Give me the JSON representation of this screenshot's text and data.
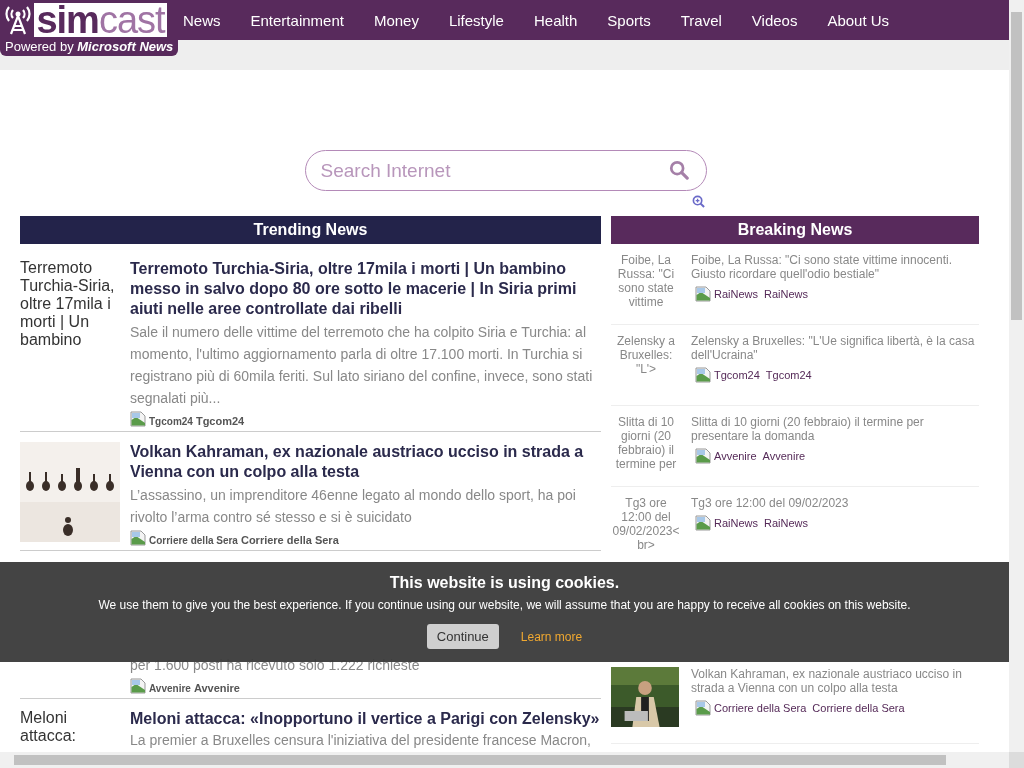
{
  "brand": {
    "logo": "**sim**cast",
    "powered_prefix": "Powered by",
    "powered_name": "Microsoft News"
  },
  "nav": [
    "News",
    "Entertainment",
    "Money",
    "Lifestyle",
    "Health",
    "Sports",
    "Travel",
    "Videos",
    "About Us"
  ],
  "search": {
    "placeholder": "Search Internet"
  },
  "trending": {
    "title": "Trending News",
    "items": [
      {
        "kind": "alt",
        "image_alt": "Terremoto Turchia-Siria, oltre 17mila i morti | Un bambino",
        "title": "Terremoto Turchia-Siria, oltre 17mila i morti | Un bambino messo in salvo dopo 80 ore sotto le macerie | In Siria primi aiuti nelle aree controllate dai ribelli",
        "summary": "Sale il numero delle vittime del terremoto che ha colpito Siria e Turchia: al momento, l'ultimo aggiornamento parla di oltre 17.100 morti. In Turchia si registrano più di 60mila feriti. Sul lato siriano del confine, invece, sono stati segnalati più...",
        "source_alt": "Tgcom24",
        "source": "Tgcom24"
      },
      {
        "kind": "picture",
        "title": "Volkan Kahraman, ex nazionale austriaco ucciso in strada a Vienna con un colpo alla testa",
        "summary": "L’assassino, un imprenditore 46enne legato al mondo dello sport, ha poi rivolto l’arma contro sé stesso e si è suicidato",
        "source_alt": "Corriere della Sera",
        "source": "Corriere della Sera"
      },
      {
        "kind": "covered",
        "summary": "per 1.600 posti ha ricevuto solo 1.222 richieste",
        "source_alt": "Avvenire",
        "source": "Avvenire"
      },
      {
        "kind": "alt",
        "image_alt": "Meloni attacca:",
        "title": "Meloni attacca: «Inopportuno il vertice a Parigi con Zelensky»",
        "summary": "La premier a Bruxelles censura l'iniziativa del presidente francese Macron,"
      }
    ]
  },
  "breaking": {
    "title": "Breaking News",
    "items": [
      {
        "kind": "alt",
        "image_alt": "Foibe, La Russa: \"Ci sono state vittime",
        "title": "Foibe, La Russa: \"Ci sono state vittime innocenti. Giusto ricordare quell'odio bestiale\"",
        "source_alt": "RaiNews",
        "source": "RaiNews"
      },
      {
        "kind": "alt",
        "image_alt": "Zelensky a Bruxelles: \"L'>",
        "title": "Zelensky a Bruxelles: \"L'Ue significa libertà, è la casa dell'Ucraina\"",
        "source_alt": "Tgcom24",
        "source": "Tgcom24"
      },
      {
        "kind": "alt",
        "image_alt": "Slitta di 10 giorni (20 febbraio) il termine per",
        "title": "Slitta di 10 giorni (20 febbraio) il termine per presentare la domanda",
        "source_alt": "Avvenire",
        "source": "Avvenire"
      },
      {
        "kind": "alt",
        "image_alt": "Tg3 ore 12:00 del 09/02/2023<br>",
        "title": "Tg3 ore 12:00 del 09/02/2023",
        "source_alt": "RaiNews",
        "source": "RaiNews"
      },
      {
        "kind": "picture",
        "title": "Volkan Kahraman, ex nazionale austriaco ucciso in strada a Vienna con un colpo alla testa",
        "source_alt": "Corriere della Sera",
        "source": "Corriere della Sera"
      }
    ]
  },
  "cookie": {
    "title": "This website is using cookies.",
    "text": "We use them to give you the best experience. If you continue using our website, we will assume that you are happy to receive all cookies on this website.",
    "button": "Continue",
    "link": "Learn more"
  }
}
